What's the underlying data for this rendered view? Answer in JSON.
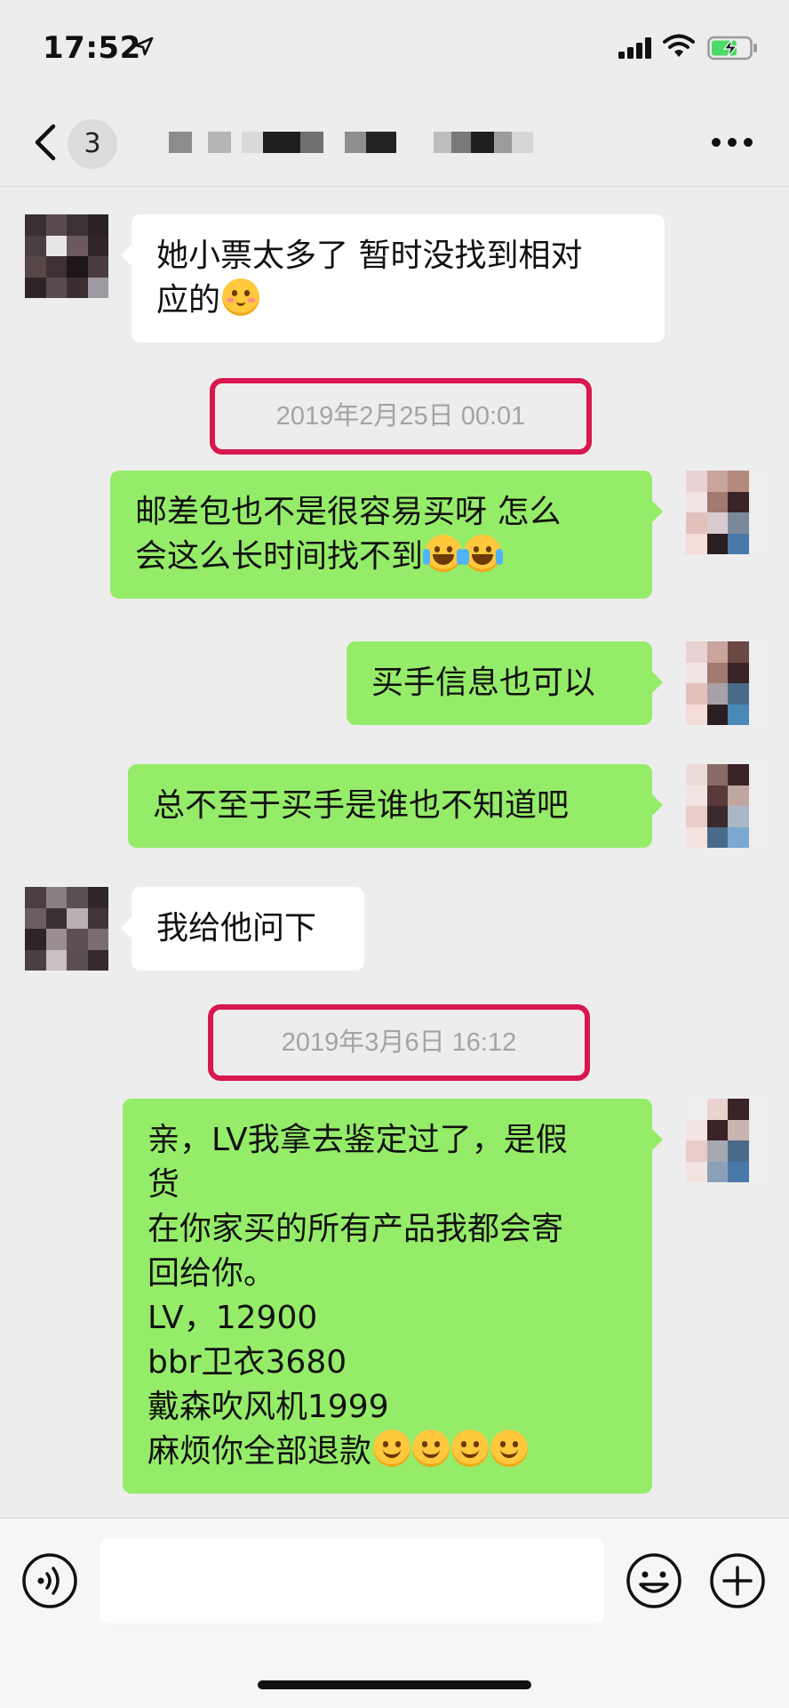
{
  "status_bar": {
    "time": "17:52",
    "icons": [
      "location-arrow-icon",
      "signal-icon",
      "wifi-icon",
      "battery-charging-icon"
    ]
  },
  "nav": {
    "unread_count": "3",
    "title": "",
    "icons": [
      "chevron-left-icon",
      "more-dots-icon"
    ]
  },
  "messages": [
    {
      "type": "incoming",
      "lines": [
        "她小票太多了 暂时没找到相对",
        "应的"
      ],
      "emoji": [
        "blush"
      ]
    },
    {
      "type": "timestamp",
      "text": "2019年2月25日 00:01"
    },
    {
      "type": "outgoing",
      "lines": [
        "邮差包也不是很容易买呀 怎么",
        "会这么长时间找不到"
      ],
      "emoji": [
        "tears",
        "tears"
      ]
    },
    {
      "type": "outgoing",
      "lines": [
        "买手信息也可以"
      ]
    },
    {
      "type": "outgoing",
      "lines": [
        "总不至于买手是谁也不知道吧"
      ]
    },
    {
      "type": "incoming",
      "lines": [
        "我给他问下"
      ]
    },
    {
      "type": "timestamp",
      "text": "2019年3月6日 16:12"
    },
    {
      "type": "outgoing",
      "lines": [
        "亲，LV我拿去鉴定过了，是假",
        "货",
        "在你家买的所有产品我都会寄",
        "回给你。",
        "LV，12900",
        "bbr卫衣3680",
        "戴森吹风机1999",
        "麻烦你全部退款"
      ],
      "emoji": [
        "smile",
        "smile",
        "smile",
        "smile"
      ]
    }
  ],
  "input_bar": {
    "value": "",
    "placeholder": "",
    "icons": [
      "voice-icon",
      "emoji-icon",
      "plus-icon"
    ]
  },
  "colors": {
    "outgoing_bubble": "#95ec69",
    "incoming_bubble": "#ffffff",
    "background": "#ededed",
    "highlight_frame": "#d8174f"
  }
}
